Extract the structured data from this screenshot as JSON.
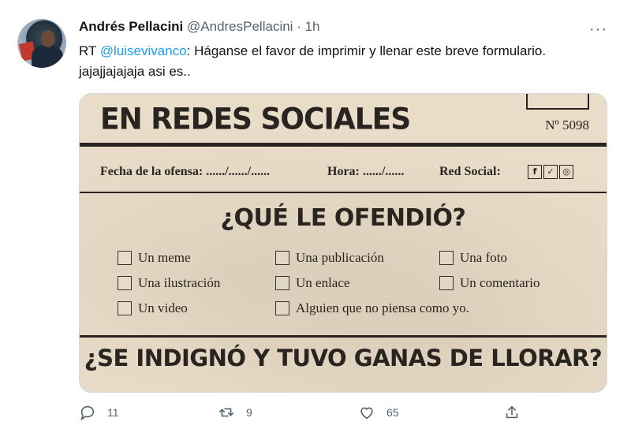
{
  "tweet": {
    "author_name": "Andrés Pellacini",
    "handle": "@AndresPellacini",
    "separator": "·",
    "time": "1h",
    "more_label": "···",
    "text_prefix": "RT ",
    "mention": "@luisevivanco",
    "text_body": ": Háganse el favor de imprimir y llenar este breve formulario.  jajajjajajaja asi es.."
  },
  "media": {
    "title": "EN REDES SOCIALES",
    "number": "Nº 5098",
    "fecha": "Fecha de la ofensa: ....../....../......",
    "hora": "Hora: ....../......",
    "red_social": "Red Social:",
    "social_icons": [
      "facebook-icon",
      "twitter-icon",
      "instagram-icon"
    ],
    "question1": "¿QUÉ LE OFENDIÓ?",
    "options": [
      "Un meme",
      "Una publicación",
      "Una foto",
      "Una ilustración",
      "Un enlace",
      "Un comentario",
      "Un video",
      "Alguien que no piensa como yo."
    ],
    "question2": "¿SE INDIGNÓ Y TUVO GANAS DE LLORAR?"
  },
  "actions": {
    "reply_count": "11",
    "retweet_count": "9",
    "like_count": "65"
  },
  "colors": {
    "link": "#1d9bf0",
    "muted": "#536471",
    "paper": "#e9ddc9"
  }
}
